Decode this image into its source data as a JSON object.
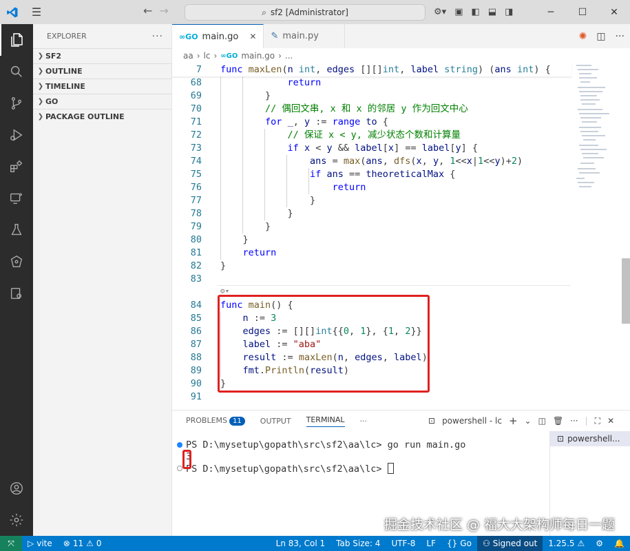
{
  "titlebar": {
    "search_text": "sf2 [Administrator]",
    "menu_icon": "hamburger-icon"
  },
  "sidebar": {
    "header": "EXPLORER",
    "sections": [
      "SF2",
      "OUTLINE",
      "TIMELINE",
      "GO",
      "PACKAGE OUTLINE"
    ]
  },
  "tabs": [
    {
      "label": "main.go",
      "active": true
    },
    {
      "label": "main.py",
      "active": false
    }
  ],
  "breadcrumbs": [
    "aa",
    "lc",
    "main.go",
    "..."
  ],
  "editor": {
    "sticky_line": {
      "num": "7"
    },
    "line_numbers": [
      "68",
      "69",
      "70",
      "71",
      "72",
      "73",
      "74",
      "75",
      "76",
      "77",
      "78",
      "79",
      "80",
      "81",
      "82",
      "83",
      "84",
      "85",
      "86",
      "87",
      "88",
      "89",
      "90",
      "91"
    ],
    "comments": {
      "l70": "// 偶回文串, x 和 x 的邻居 y 作为回文中心",
      "l72": "// 保证 x < y, 减少状态个数和计算量"
    },
    "strings": {
      "aba": "\"aba\""
    }
  },
  "panel": {
    "tabs": [
      {
        "label": "PROBLEMS",
        "badge": "11"
      },
      {
        "label": "OUTPUT"
      },
      {
        "label": "TERMINAL"
      }
    ],
    "terminal_name": "powershell - lc",
    "terminal_list_item": "powershell...",
    "terminal": {
      "line1_prompt": "PS D:\\mysetup\\gopath\\src\\sf2\\aa\\lc>",
      "line1_cmd": "go run main.go",
      "output": "3",
      "line3_prompt": "PS D:\\mysetup\\gopath\\src\\sf2\\aa\\lc>"
    },
    "watermark": "掘金技术社区 @ 福大大架构师每日一题"
  },
  "statusbar": {
    "vite": "vite",
    "errors": "11",
    "warnings": "0",
    "position": "Ln 83, Col 1",
    "tab_size": "Tab Size: 4",
    "encoding": "UTF-8",
    "eol": "LF",
    "language": "Go",
    "signed": "Signed out",
    "go_version": "1.25.5"
  },
  "colors": {
    "accent": "#007acc",
    "highlight_box": "#e02020"
  }
}
